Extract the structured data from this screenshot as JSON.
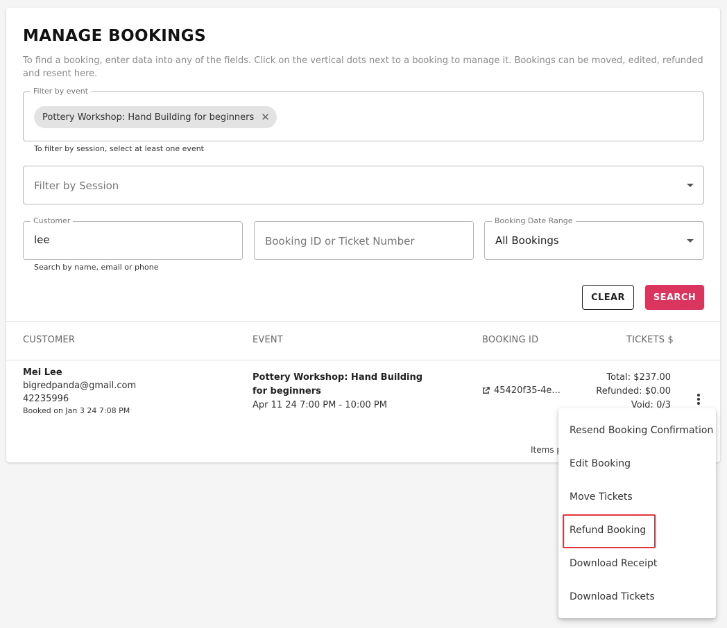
{
  "page": {
    "title": "MANAGE BOOKINGS",
    "description": "To find a booking, enter data into any of the fields. Click on the vertical dots next to a booking to manage it. Bookings can be moved, edited, refunded and resent here."
  },
  "filters": {
    "event": {
      "legend": "Filter by event",
      "chip_label": "Pottery Workshop: Hand Building for beginners",
      "helper": "To filter by session, select at least one event"
    },
    "session": {
      "placeholder": "Filter by Session"
    },
    "customer": {
      "legend": "Customer",
      "value": "lee",
      "helper": "Search by name, email or phone"
    },
    "booking_id": {
      "placeholder": "Booking ID or Ticket Number"
    },
    "date_range": {
      "legend": "Booking Date Range",
      "value": "All Bookings"
    }
  },
  "actions": {
    "clear_label": "CLEAR",
    "search_label": "SEARCH"
  },
  "table": {
    "headers": {
      "customer": "CUSTOMER",
      "event": "EVENT",
      "booking_id": "BOOKING ID",
      "tickets": "TICKETS $"
    },
    "rows": [
      {
        "customer_name": "Mei Lee",
        "customer_email": "bigredpanda@gmail.com",
        "customer_phone": "42235996",
        "booked_on": "Booked on Jan 3 24 7:08 PM",
        "event_name": "Pottery Workshop: Hand Building for beginners",
        "event_date": "Apr 11 24 7:00 PM - 10:00 PM",
        "booking_id": "45420f35-4e...",
        "total": "Total: $237.00",
        "refunded": "Refunded: $0.00",
        "void": "Void: 0/3"
      }
    ],
    "footer_items_per": "Items pe"
  },
  "menu": {
    "items": [
      "Resend Booking Confirmation",
      "Edit Booking",
      "Move Tickets",
      "Refund Booking",
      "Download Receipt",
      "Download Tickets"
    ]
  },
  "colors": {
    "accent": "#d9355e",
    "highlight": "#e0353b"
  },
  "icons": {
    "chip_remove": "close-icon",
    "dropdown": "chevron-down-icon",
    "booking_link": "external-link-icon",
    "row_menu": "more-vert-icon"
  }
}
